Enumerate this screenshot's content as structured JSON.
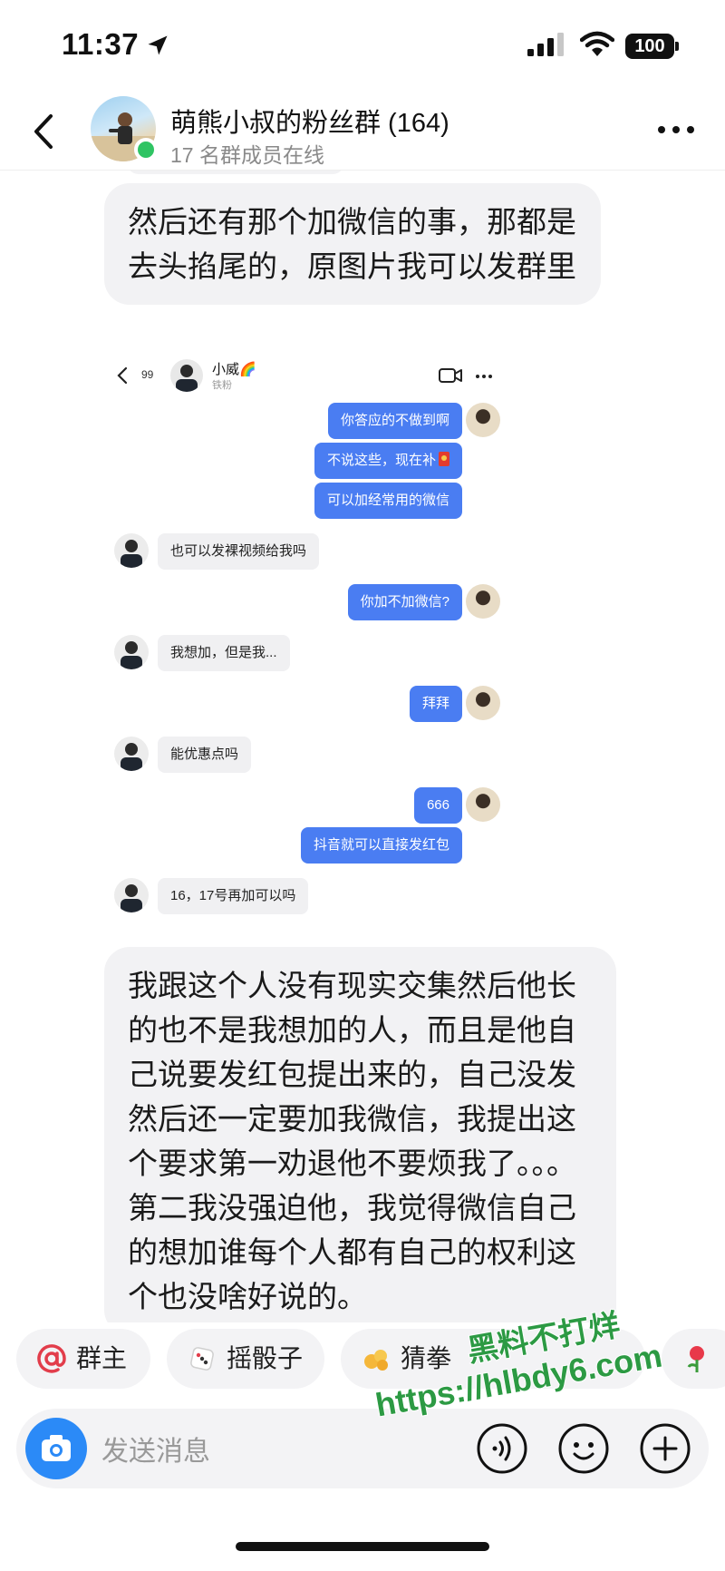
{
  "status_bar": {
    "time": "11:37",
    "battery": "100"
  },
  "header": {
    "title": "萌熊小叔的粉丝群 (164)",
    "subtitle": "17 名群成员在线"
  },
  "messages": [
    {
      "text": "然后还有那个加微信的事，那都是去头掐尾的，原图片我可以发群里"
    },
    {
      "text": "我跟这个人没有现实交集然后他长的也不是我想加的人，而且是他自己说要发红包提出来的，自己没发然后还一定要加我微信，我提出这个要求第一劝退他不要烦我了。。。第二我没强迫他，我觉得微信自己的想加谁每个人都有自己的权利这个也没啥好说的。"
    }
  ],
  "embedded_chat": {
    "back_count": "99",
    "contact_name": "小威🌈",
    "contact_sub": "铁粉",
    "rows": [
      {
        "side": "me",
        "text": "你答应的不做到啊"
      },
      {
        "side": "me",
        "text": "不说这些，现在补"
      },
      {
        "side": "me",
        "text": "可以加经常用的微信"
      },
      {
        "side": "them",
        "text": "也可以发裸视频给我吗"
      },
      {
        "side": "me",
        "text": "你加不加微信?"
      },
      {
        "side": "them",
        "text": "我想加，但是我..."
      },
      {
        "side": "me",
        "text": "拜拜"
      },
      {
        "side": "them",
        "text": "能优惠点吗"
      },
      {
        "side": "me",
        "text": "666"
      },
      {
        "side": "me",
        "text": "抖音就可以直接发红包"
      },
      {
        "side": "them",
        "text": "16，17号再加可以吗"
      }
    ]
  },
  "quick_actions": [
    {
      "icon": "at-icon",
      "label": "群主"
    },
    {
      "icon": "dice-icon",
      "label": "摇骰子"
    },
    {
      "icon": "fist-icon",
      "label": "猜拳"
    },
    {
      "icon": "rose-icon",
      "label": ""
    }
  ],
  "watermark": {
    "line1": "黑料不打烊",
    "line2": "https://hlbdy6.com"
  },
  "input": {
    "placeholder": "发送消息"
  },
  "colors": {
    "accent": "#2b8af7",
    "embedded_me_bubble": "#4a7df2",
    "online": "#2fc463",
    "watermark": "#2c9a43"
  }
}
